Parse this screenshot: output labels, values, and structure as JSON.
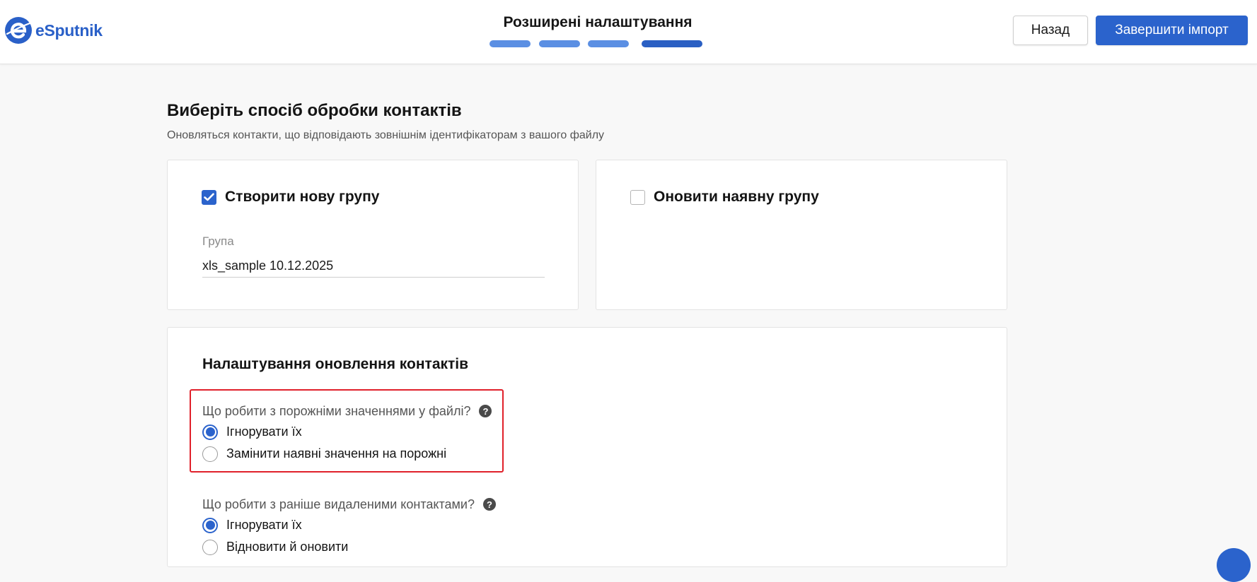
{
  "app": {
    "logo_text": "eSputnik"
  },
  "header": {
    "step_title": "Розширені налаштування",
    "back_label": "Назад",
    "finish_label": "Завершити імпорт"
  },
  "page": {
    "title": "Виберіть спосіб обробки контактів",
    "subtitle": "Оновляться контакти, що відповідають зовнішнім ідентифікаторам з вашого файлу"
  },
  "create_group": {
    "label": "Створити нову групу",
    "checked": true,
    "field_label": "Група",
    "field_value": "xls_sample 10.12.2025"
  },
  "update_group": {
    "label": "Оновити наявну групу",
    "checked": false
  },
  "update_settings": {
    "title": "Налаштування оновлення контактів",
    "questions": [
      {
        "text": "Що робити з порожніми значеннями у файлі?",
        "help_icon": "question-circle-icon",
        "options": [
          {
            "label": "Ігнорувати їх",
            "selected": true
          },
          {
            "label": "Замінити наявні значення на порожні",
            "selected": false
          }
        ]
      },
      {
        "text": "Що робити з раніше видаленими контактами?",
        "help_icon": "question-circle-icon",
        "options": [
          {
            "label": "Ігнорувати їх",
            "selected": true
          },
          {
            "label": "Відновити й оновити",
            "selected": false
          }
        ]
      }
    ]
  },
  "colors": {
    "accent": "#2b63cc",
    "highlight": "#e0202a",
    "background": "#f8f8f8"
  }
}
